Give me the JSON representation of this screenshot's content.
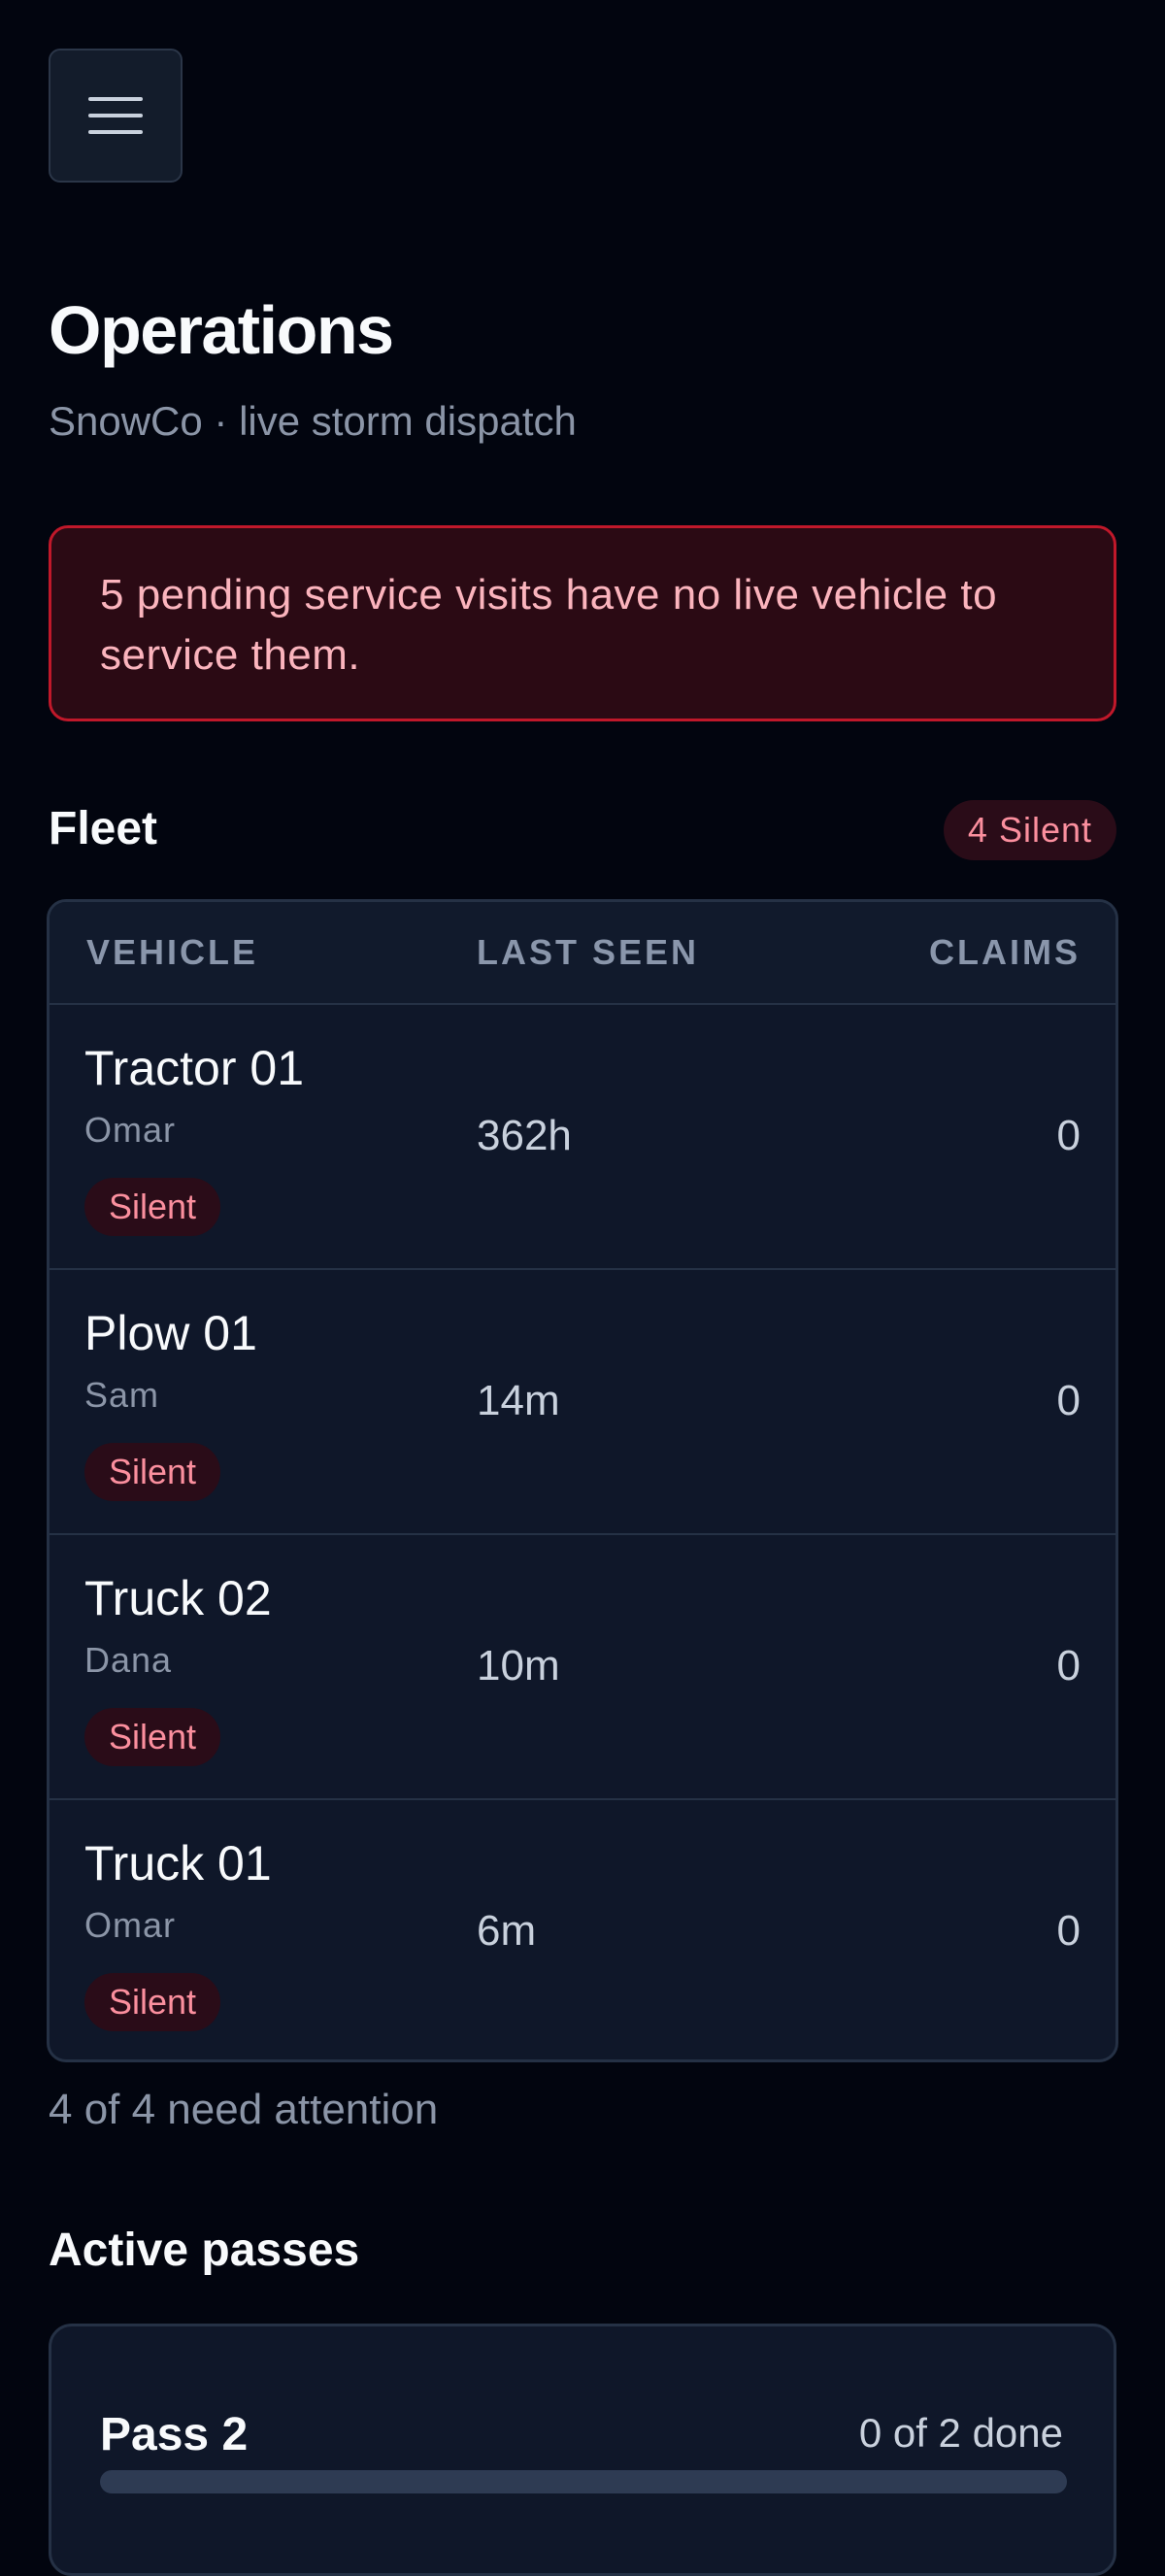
{
  "header": {
    "menu_icon": "hamburger-icon",
    "title": "Operations",
    "subtitle": "SnowCo · live storm dispatch"
  },
  "alert": {
    "message": "5 pending service visits have no live vehicle to service them."
  },
  "fleet": {
    "title": "Fleet",
    "silent_badge": "4 Silent",
    "columns": [
      "VEHICLE",
      "LAST SEEN",
      "CLAIMS"
    ],
    "rows": [
      {
        "name": "Tractor 01",
        "driver": "Omar",
        "status": "Silent",
        "last_seen": "362h",
        "claims": "0"
      },
      {
        "name": "Plow 01",
        "driver": "Sam",
        "status": "Silent",
        "last_seen": "14m",
        "claims": "0"
      },
      {
        "name": "Truck 02",
        "driver": "Dana",
        "status": "Silent",
        "last_seen": "10m",
        "claims": "0"
      },
      {
        "name": "Truck 01",
        "driver": "Omar",
        "status": "Silent",
        "last_seen": "6m",
        "claims": "0"
      }
    ],
    "summary": "4 of 4 need attention"
  },
  "passes": {
    "title": "Active passes",
    "items": [
      {
        "name": "Pass 2",
        "progress_label": "0 of 2 done",
        "done": 0,
        "total": 2
      }
    ]
  },
  "colors": {
    "background": "#02050f",
    "danger": "#c0182a",
    "danger_text": "#fb8f9e"
  }
}
